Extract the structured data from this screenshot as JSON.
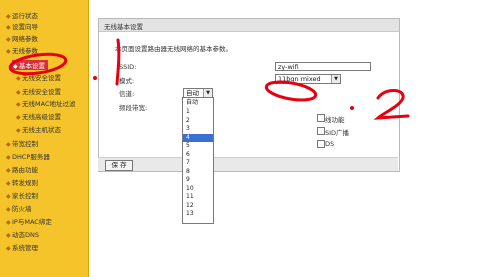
{
  "sidebar": {
    "items": [
      {
        "label": "运行状态"
      },
      {
        "label": "设置向导"
      },
      {
        "label": "网络参数"
      },
      {
        "label": "无线参数"
      },
      {
        "label": "基本设置"
      },
      {
        "label": "无线安全设置"
      },
      {
        "label": "无线安全设置"
      },
      {
        "label": "无线MAC地址过滤"
      },
      {
        "label": "无线高级设置"
      },
      {
        "label": "无线主机状态"
      },
      {
        "label": "带宽控制"
      },
      {
        "label": "DHCP服务器"
      },
      {
        "label": "路由功能"
      },
      {
        "label": "转发规则"
      },
      {
        "label": "家长控制"
      },
      {
        "label": "防火墙"
      },
      {
        "label": "IP与MAC绑定"
      },
      {
        "label": "动态DNS"
      },
      {
        "label": "系统管理"
      }
    ]
  },
  "panel": {
    "title": "无线基本设置",
    "intro": "本页面设置路由器无线网络的基本参数。",
    "ssid_label": "SSID:",
    "ssid_value": "zy-wifi",
    "mode_label": "模式:",
    "mode_value": "11bgn mixed",
    "channel_label": "信道:",
    "channel_value": "自动",
    "bandwidth_label": "频段带宽:",
    "wireless_func_label": "线功能",
    "ssid_broadcast_label": "SID广播",
    "wds_label": "DS",
    "save_label": "保 存"
  },
  "channel_options": [
    "自动",
    "1",
    "2",
    "3",
    "4",
    "5",
    "6",
    "7",
    "8",
    "9",
    "10",
    "11",
    "12",
    "13"
  ],
  "channel_highlighted": "4",
  "annotations": {
    "step1": ".1",
    "step2": ".2"
  },
  "colors": {
    "sidebar_bg": "#f5c42a",
    "active_item_bg": "#d6303a",
    "highlight": "#3a6fd6",
    "annotation": "#e60012"
  }
}
